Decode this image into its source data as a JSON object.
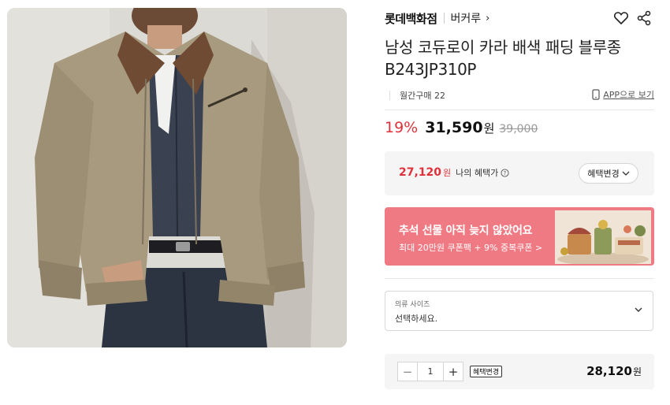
{
  "product": {
    "image_alt": "tan corduroy-collar padded blouson worn over denim",
    "store_name": "롯데백화점",
    "brand_name": "버커루",
    "title": "남성 코듀로이 카라 배색 패딩 블루종 B243JP310P",
    "monthly_purchases": "월간구매 22",
    "app_link": "APP으로 보기"
  },
  "pricing": {
    "discount_pct": "19%",
    "sale_price": "31,590",
    "currency": "원",
    "original_price": "39,000"
  },
  "benefit": {
    "my_price": "27,120",
    "currency": "원",
    "label": "나의 혜택가",
    "change_button": "혜택변경"
  },
  "banner": {
    "title": "추석 선물 아직 늦지 않았어요",
    "subtitle": "최대 20만원 쿠폰팩 + 9% 중복쿠폰 >"
  },
  "option": {
    "label": "의류 사이즈",
    "value": "선택하세요."
  },
  "order": {
    "minus": "−",
    "quantity": "1",
    "plus": "+",
    "benefit_button": "혜택변경",
    "total_price": "28,120",
    "currency": "원"
  },
  "colors": {
    "accent_red": "#e0313a",
    "banner_pink": "#ef7a83",
    "panel_gray": "#f5f5f5"
  },
  "icons": [
    "heart-icon",
    "share-icon",
    "phone-icon",
    "info-icon",
    "chevron-down-icon",
    "chevron-right-icon"
  ]
}
